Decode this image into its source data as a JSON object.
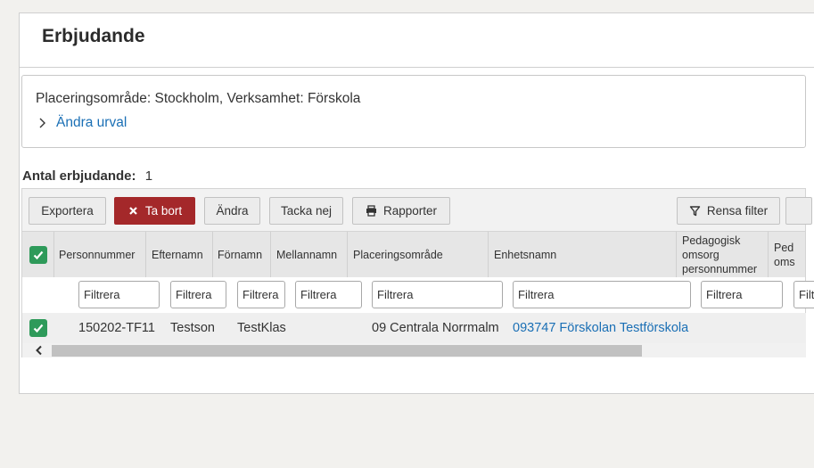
{
  "page": {
    "title": "Erbjudande"
  },
  "selection": {
    "summary": "Placeringsområde: Stockholm, Verksamhet: Förskola",
    "change_link": "Ändra urval"
  },
  "count": {
    "label": "Antal erbjudande:",
    "value": "1"
  },
  "toolbar": {
    "export": "Exportera",
    "delete": "Ta bort",
    "change": "Ändra",
    "decline": "Tacka nej",
    "reports": "Rapporter",
    "clear_filter": "Rensa filter"
  },
  "table": {
    "columns": [
      "Personnummer",
      "Efternamn",
      "Förnamn",
      "Mellannamn",
      "Placeringsområde",
      "Enhetsnamn",
      "Pedagogisk omsorg personnummer",
      "Ped oms"
    ],
    "filter_placeholder": "Filtrera",
    "rows": [
      {
        "checked": true,
        "personnummer": "150202-TF11",
        "efternamn": "Testson",
        "fornamn": "TestKlas",
        "mellannamn": "",
        "placeringsomrade": "09 Centrala Norrmalm",
        "enhetsnamn": "093747 Förskolan Testförskola"
      }
    ]
  },
  "colors": {
    "accent_link": "#1a6fb5",
    "danger": "#a4282a",
    "checkbox": "#2e9a5a"
  },
  "icons": {
    "change_link": "chevron-right-icon",
    "delete": "close-icon",
    "reports": "printer-icon",
    "clear_filter": "filter-icon",
    "scroll_left": "chevron-left-icon",
    "checkbox": "check-icon"
  }
}
